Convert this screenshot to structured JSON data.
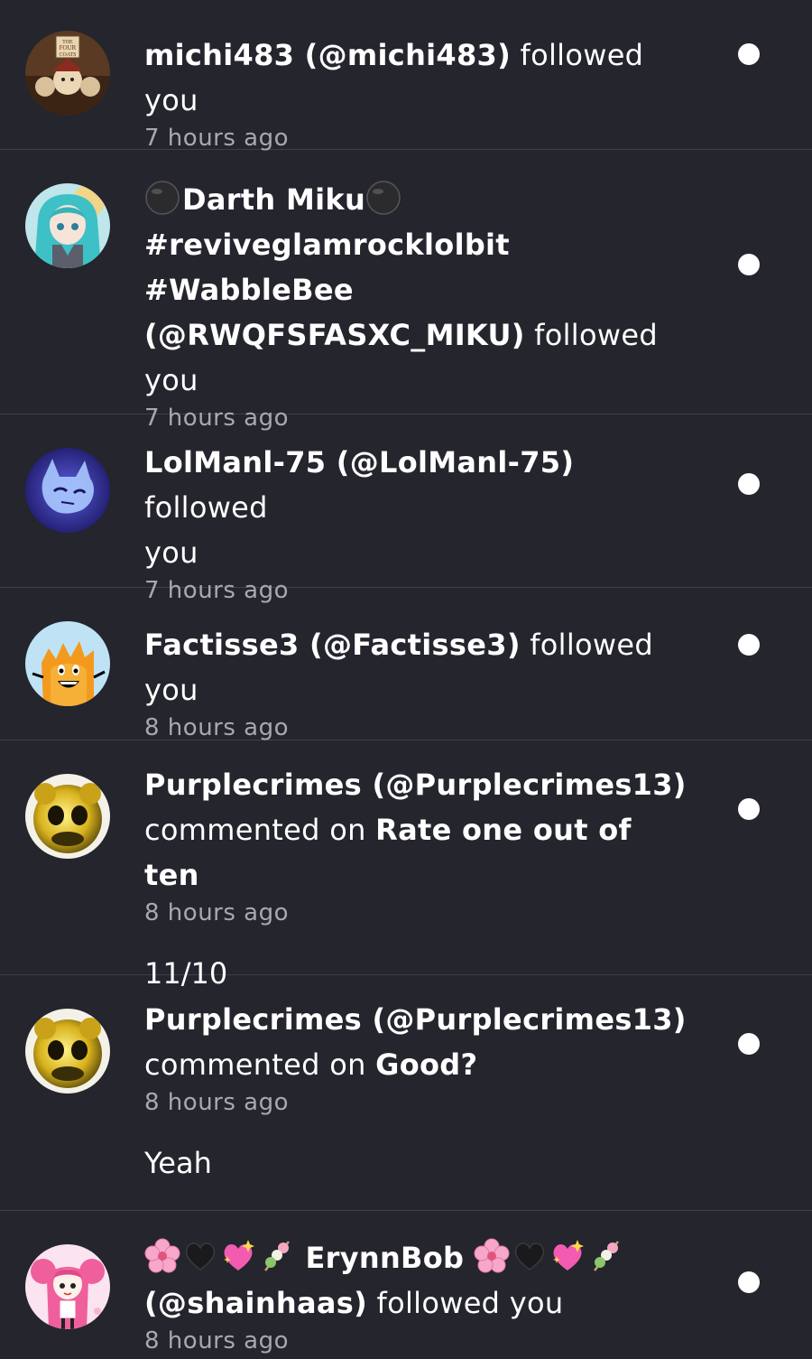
{
  "notifications": [
    {
      "name": "michi483 (@michi483)",
      "action": " followed you",
      "time": "7 hours ago",
      "avatar": "four-coats-avatar"
    },
    {
      "name_main": "Darth Miku",
      "name_line2": "#reviveglamrocklolbit #WabbleBee",
      "handle": "(@RWQFSFASXC_MIKU)",
      "action": " followed",
      "action2": "you",
      "time": "7 hours ago",
      "avatar": "miku-avatar",
      "emoji": "black-circle"
    },
    {
      "name": "LolManl-75 (@LolManl-75)",
      "action": " followed",
      "action2": "you",
      "time": "7 hours ago",
      "avatar": "blue-cat-avatar"
    },
    {
      "name": "Factisse3 (@Factisse3)",
      "action": " followed you",
      "time": "8 hours ago",
      "avatar": "firey-avatar"
    },
    {
      "name": "Purplecrimes (@Purplecrimes13)",
      "action": "commented on ",
      "post": "Rate one out of ten",
      "time": "8 hours ago",
      "comment": "11/10",
      "avatar": "golden-animatronic-avatar"
    },
    {
      "name": "Purplecrimes (@Purplecrimes13)",
      "action": "commented on ",
      "post": "Good?",
      "time": "8 hours ago",
      "comment": "Yeah",
      "avatar": "golden-animatronic-avatar"
    },
    {
      "name_main": "ErynnBob",
      "handle": "(@shainhaas)",
      "action": " followed you",
      "time": "8 hours ago",
      "avatar": "pink-anime-girl-avatar",
      "emoji": [
        "cherry-blossom",
        "black-heart",
        "sparkling-heart",
        "dango"
      ]
    }
  ],
  "colors": {
    "background": "#24252d",
    "divider": "#3f4049",
    "text": "#ffffff",
    "timestamp": "#a8a9b0",
    "unread_dot": "#ffffff"
  }
}
